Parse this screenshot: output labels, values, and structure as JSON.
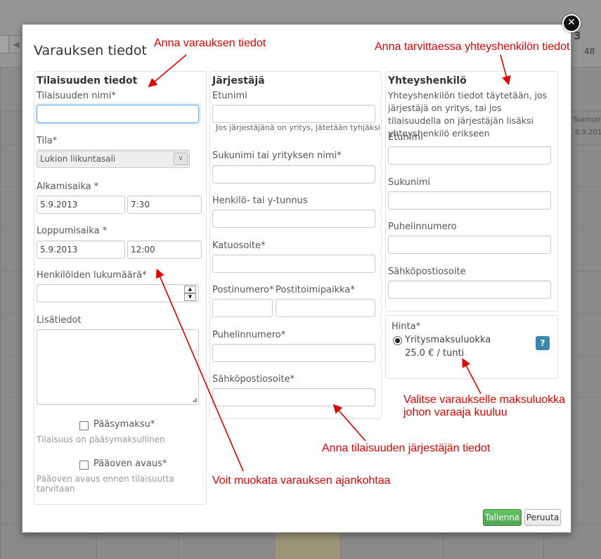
{
  "background": {
    "week_number": "3",
    "week_number_2": "48",
    "sunday_label": "Sunnunt",
    "sunday_date": "8.9.201"
  },
  "modal": {
    "title": "Varauksen tiedot",
    "close_icon": "close-icon"
  },
  "event": {
    "section_title": "Tilaisuuden tiedot",
    "name_label": "Tilaisuuden nimi*",
    "name_value": "",
    "room_label": "Tila*",
    "room_value": "Lukion liikuntasali",
    "start_label": "Alkamisaika *",
    "start_date": "5.9.2013",
    "start_time": "7:30",
    "end_label": "Loppumisaika *",
    "end_date": "5.9.2013",
    "end_time": "12:00",
    "count_label": "Henkilöiden lukumäärä*",
    "count_value": "",
    "notes_label": "Lisätiedot",
    "fee_label": "Pääsymaksu*",
    "fee_help": "Tilaisuus on pääsymaksullinen",
    "door_label": "Pääoven avaus*",
    "door_help": "Pääoven avaus ennen tilaisuutta tarvitaan"
  },
  "organizer": {
    "section_title": "Järjestäjä",
    "firstname_label": "Etunimi",
    "firstname_help": "Jos järjestäjänä on yritys, jätetään tyhjäksi",
    "lastname_label": "Sukunimi tai yrityksen nimi*",
    "id_label": "Henkilö- tai y-tunnus",
    "street_label": "Katuosoite*",
    "postcode_label": "Postinumero*",
    "city_label": "Postitoimipaikka*",
    "phone_label": "Puhelinnumero*",
    "email_label": "Sähköpostiosoite*"
  },
  "contact": {
    "section_title": "Yhteyshenkilö",
    "description": "Yhteyshenkilön tiedot täytetään, jos järjestäjä on yritys, tai jos tilaisuudella on järjestäjän lisäksi yhteyshenkilö erikseen",
    "firstname_label": "Etunimi",
    "lastname_label": "Sukunimi",
    "phone_label": "Puhelinnumero",
    "email_label": "Sähköpostiosoite"
  },
  "price": {
    "label": "Hinta*",
    "option_label": "Yritysmaksuluokka",
    "option_price": "25.0 € / tunti",
    "help_button": "?"
  },
  "buttons": {
    "save": "Tallenna",
    "cancel": "Peruuta"
  },
  "annotations": {
    "a1": "Anna varauksen tiedot",
    "a2": "Anna tarvittaessa yhteyshenkilön tiedot",
    "a3_line1": "Valitse varaukselle maksuluokka",
    "a3_line2": "johon varaaja kuuluu",
    "a4": "Anna tilaisuuden järjestäjän tiedot",
    "a5": "Voit muokata varauksen ajankohtaa"
  },
  "colors": {
    "annotation": "#e00000",
    "save_button": "#5bb75b",
    "help_button": "#3a87ad",
    "focus": "#66afe9"
  }
}
